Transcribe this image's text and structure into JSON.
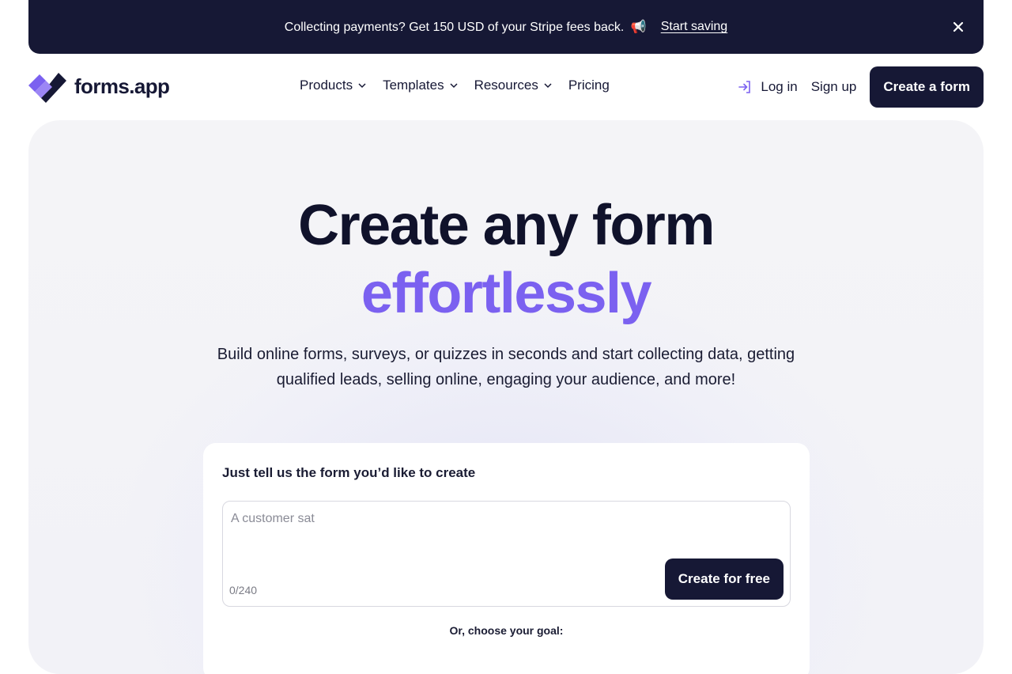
{
  "banner": {
    "text": "Collecting payments? Get 150 USD of your Stripe fees back.",
    "emoji": "📢",
    "link_label": "Start saving"
  },
  "nav": {
    "logo_text": "forms.app",
    "menu": [
      {
        "label": "Products",
        "has_dropdown": true
      },
      {
        "label": "Templates",
        "has_dropdown": true
      },
      {
        "label": "Resources",
        "has_dropdown": true
      },
      {
        "label": "Pricing",
        "has_dropdown": false
      }
    ],
    "login_label": "Log in",
    "signup_label": "Sign up",
    "cta_label": "Create a form"
  },
  "hero": {
    "title_line1": "Create any form",
    "title_line2": "effortlessly",
    "subtitle": "Build online forms, surveys, or quizzes in seconds and start collecting data, getting qualified leads, selling online, engaging your audience, and more!"
  },
  "generator": {
    "title": "Just tell us the form you’d like to create",
    "placeholder": "A customer sat",
    "counter": "0/240",
    "button_label": "Create for free",
    "goal_label": "Or, choose your goal:"
  },
  "colors": {
    "dark": "#161835",
    "accent": "#7b61f0"
  }
}
